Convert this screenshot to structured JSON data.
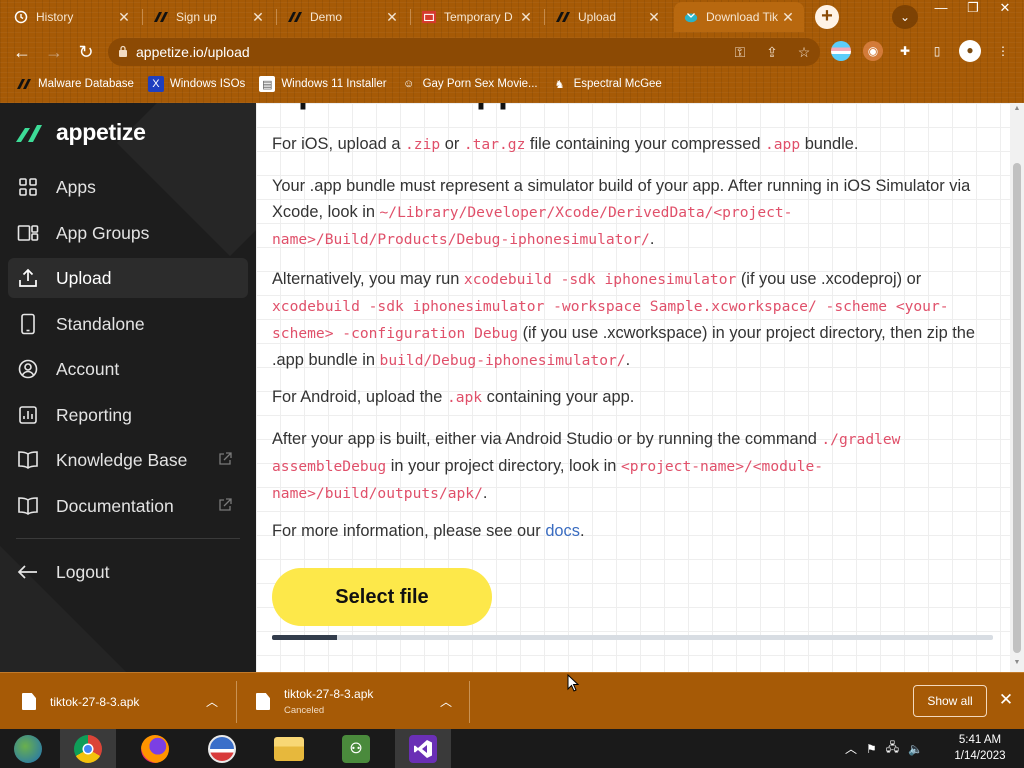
{
  "browser": {
    "tabs": [
      {
        "title": "History",
        "icon": "history-icon",
        "active": false
      },
      {
        "title": "Sign up",
        "icon": "appetize-icon",
        "active": false
      },
      {
        "title": "Demo",
        "icon": "appetize-icon",
        "active": false
      },
      {
        "title": "Temporary D",
        "icon": "mail-icon",
        "active": false
      },
      {
        "title": "Upload",
        "icon": "appetize-icon",
        "active": false
      },
      {
        "title": "Download Tik",
        "icon": "download-site-icon",
        "active": true
      }
    ],
    "new_tab_label": "+",
    "url": "appetize.io/upload",
    "bookmarks": [
      {
        "label": "Malware Database",
        "icon": "appetize-icon"
      },
      {
        "label": "Windows ISOs",
        "icon": "x-logo-icon"
      },
      {
        "label": "Windows 11 Installer",
        "icon": "page-icon"
      },
      {
        "label": "Gay Porn Sex Movie...",
        "icon": "bookmark-site-icon"
      },
      {
        "label": "Espectral McGee",
        "icon": "bookmark-site-icon"
      }
    ]
  },
  "sidebar": {
    "brand": "appetize",
    "items": [
      {
        "label": "Apps",
        "icon": "grid-icon",
        "active": false,
        "external": false
      },
      {
        "label": "App Groups",
        "icon": "app-groups-icon",
        "active": false,
        "external": false
      },
      {
        "label": "Upload",
        "icon": "upload-icon",
        "active": true,
        "external": false
      },
      {
        "label": "Standalone",
        "icon": "phone-icon",
        "active": false,
        "external": false
      },
      {
        "label": "Account",
        "icon": "account-icon",
        "active": false,
        "external": false
      },
      {
        "label": "Reporting",
        "icon": "chart-icon",
        "active": false,
        "external": false
      },
      {
        "label": "Knowledge Base",
        "icon": "book-icon",
        "active": false,
        "external": true
      },
      {
        "label": "Documentation",
        "icon": "book-icon",
        "active": false,
        "external": true
      }
    ],
    "logout": "Logout"
  },
  "main": {
    "heading": "Upload an app",
    "p1": {
      "t1": "For iOS, upload a ",
      "c1": ".zip",
      "t2": " or ",
      "c2": ".tar.gz",
      "t3": " file containing your compressed ",
      "c3": ".app",
      "t4": " bundle."
    },
    "p2": {
      "t1": "Your .app bundle must represent a simulator build of your app. After running in iOS Simulator via Xcode, look in ",
      "c1": "~/Library/Developer/Xcode/DerivedData/<project-name>/Build/Products/Debug-iphonesimulator/",
      "t2": "."
    },
    "p3": {
      "t1": "Alternatively, you may run ",
      "c1": "xcodebuild -sdk iphonesimulator",
      "t2": " (if you use .xcodeproj) or ",
      "c2": "xcodebuild -sdk iphonesimulator -workspace Sample.xcworkspace/ -scheme <your-scheme> -configuration Debug",
      "t3": " (if you use .xcworkspace) in your project directory, then zip the .app bundle in ",
      "c3": "build/Debug-iphonesimulator/",
      "t4": "."
    },
    "p4": {
      "t1": "For Android, upload the ",
      "c1": ".apk",
      "t2": " containing your app."
    },
    "p5": {
      "t1": "After your app is built, either via Android Studio or by running the command ",
      "c1": "./gradlew assembleDebug",
      "t2": " in your project directory, look in ",
      "c2": "<project-name>/<module-name>/build/outputs/apk/",
      "t3": "."
    },
    "p6": {
      "t1": "For more information, please see our ",
      "link": "docs",
      "t2": "."
    },
    "select_file_button": "Select file",
    "upload_progress_percent": 9
  },
  "downloads": {
    "items": [
      {
        "filename": "tiktok-27-8-3.apk",
        "status": ""
      },
      {
        "filename": "tiktok-27-8-3.apk",
        "status": "Canceled"
      }
    ],
    "show_all": "Show all"
  },
  "taskbar": {
    "apps": [
      "windows-start-icon",
      "chrome-icon",
      "firefox-icon",
      "obama-logo-icon",
      "file-explorer-icon",
      "network-users-icon",
      "visual-studio-icon"
    ],
    "time": "5:41 AM",
    "date": "1/14/2023"
  },
  "colors": {
    "brand_green": "#3ddc97",
    "accent_yellow": "#fde84a",
    "code_red": "#e0506a",
    "chrome_orange": "#a65a06"
  }
}
